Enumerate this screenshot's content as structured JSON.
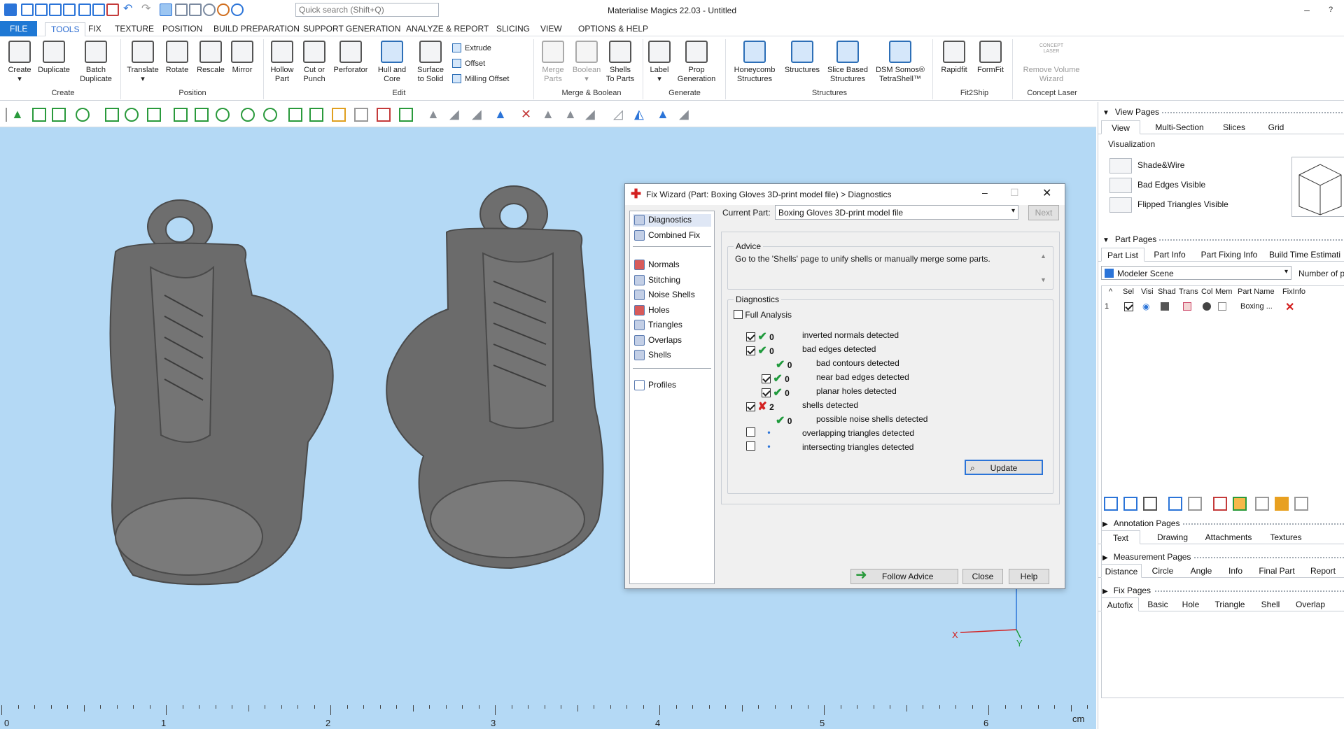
{
  "app": {
    "title": "Materialise Magics 22.03 - Untitled",
    "search_placeholder": "Quick search (Shift+Q)"
  },
  "menu": [
    "FILE",
    "TOOLS",
    "FIX",
    "TEXTURE",
    "POSITION",
    "BUILD PREPARATION",
    "SUPPORT GENERATION",
    "ANALYZE & REPORT",
    "SLICING",
    "VIEW",
    "OPTIONS & HELP"
  ],
  "ribbon": {
    "create": {
      "label": "Create",
      "duplicate": "Duplicate",
      "batch_duplicate_1": "Batch",
      "batch_duplicate_2": "Duplicate",
      "group": "Create"
    },
    "position": {
      "translate": "Translate",
      "rotate": "Rotate",
      "rescale": "Rescale",
      "mirror": "Mirror",
      "group": "Position"
    },
    "edit": {
      "hollow_1": "Hollow",
      "hollow_2": "Part",
      "cut_1": "Cut or",
      "cut_2": "Punch",
      "perforator": "Perforator",
      "hull_1": "Hull and",
      "hull_2": "Core",
      "surface_1": "Surface",
      "surface_2": "to Solid",
      "extrude": "Extrude",
      "offset": "Offset",
      "milling_offset": "Milling Offset",
      "group": "Edit"
    },
    "merge": {
      "merge_1": "Merge",
      "merge_2": "Parts",
      "boolean": "Boolean",
      "shells_1": "Shells",
      "shells_2": "To Parts",
      "group": "Merge & Boolean"
    },
    "generate": {
      "label": "Label",
      "prop_1": "Prop",
      "prop_2": "Generation",
      "group": "Generate"
    },
    "structures": {
      "honeycomb_1": "Honeycomb",
      "honeycomb_2": "Structures",
      "structures": "Structures",
      "slice_1": "Slice Based",
      "slice_2": "Structures",
      "dsm_1": "DSM Somos®",
      "dsm_2": "TetraShell™",
      "group": "Structures"
    },
    "fit2ship": {
      "rapidfit": "Rapidfit",
      "formfit": "FormFit",
      "group": "Fit2Ship"
    },
    "concept": {
      "logo_1": "CONCEPT",
      "logo_2": "LASER",
      "remove_1": "Remove Volume",
      "remove_2": "Wizard",
      "group": "Concept Laser"
    }
  },
  "ruler": {
    "ticks": [
      "0",
      "1",
      "2",
      "3",
      "4",
      "5",
      "6"
    ],
    "unit": "cm"
  },
  "axes": {
    "x": "X",
    "y": "Y"
  },
  "right_panel": {
    "view_pages": "View Pages",
    "view_tabs": [
      "View",
      "Multi-Section",
      "Slices",
      "Grid"
    ],
    "visualization": "Visualization",
    "vis_items": [
      "Shade&Wire",
      "Bad Edges Visible",
      "Flipped Triangles Visible"
    ],
    "part_pages": "Part Pages",
    "part_tabs": [
      "Part List",
      "Part Info",
      "Part Fixing Info",
      "Build Time Estimati"
    ],
    "scene": "Modeler Scene",
    "number_of": "Number of p",
    "columns": [
      "^",
      "Sel",
      "Visi",
      "Shad",
      "Trans",
      "Col",
      "Mem",
      "Part Name",
      "FixInfo"
    ],
    "row": {
      "index": "1",
      "name": "Boxing ..."
    },
    "annotation_pages": "Annotation Pages",
    "annotation_tabs": [
      "Text",
      "Drawing",
      "Attachments",
      "Textures"
    ],
    "measurement_pages": "Measurement Pages",
    "measurement_tabs": [
      "Distance",
      "Circle",
      "Angle",
      "Info",
      "Final Part",
      "Report"
    ],
    "fix_pages": "Fix Pages",
    "fix_tabs": [
      "Autofix",
      "Basic",
      "Hole",
      "Triangle",
      "Shell",
      "Overlap"
    ]
  },
  "dialog": {
    "title": "Fix Wizard (Part: Boxing Gloves 3D-print model file) > Diagnostics",
    "nav": [
      "Diagnostics",
      "Combined Fix",
      "Normals",
      "Stitching",
      "Noise Shells",
      "Holes",
      "Triangles",
      "Overlaps",
      "Shells",
      "Profiles"
    ],
    "current_part_label": "Current Part:",
    "current_part_value": "Boxing Gloves 3D-print model file",
    "next": "Next",
    "advice_legend": "Advice",
    "advice_text": "Go to the 'Shells' page to unify shells or manually merge some parts.",
    "diagnostics_legend": "Diagnostics",
    "full_analysis": "Full Analysis",
    "rows": [
      {
        "count": "0",
        "label": "inverted normals detected"
      },
      {
        "count": "0",
        "label": "bad edges detected"
      },
      {
        "count": "0",
        "label": "bad contours detected"
      },
      {
        "count": "0",
        "label": "near bad edges detected"
      },
      {
        "count": "0",
        "label": "planar holes detected"
      },
      {
        "count": "2",
        "label": "shells detected"
      },
      {
        "count": "0",
        "label": "possible noise shells detected"
      },
      {
        "count": "•",
        "label": "overlapping triangles detected"
      },
      {
        "count": "•",
        "label": "intersecting triangles detected"
      }
    ],
    "update": "Update",
    "follow_advice": "Follow Advice",
    "close": "Close",
    "help": "Help"
  },
  "colors": {
    "accent": "#1e78d4",
    "viewport": "#b4d9f5",
    "ok": "#1f9a3c",
    "error": "#d32020"
  }
}
